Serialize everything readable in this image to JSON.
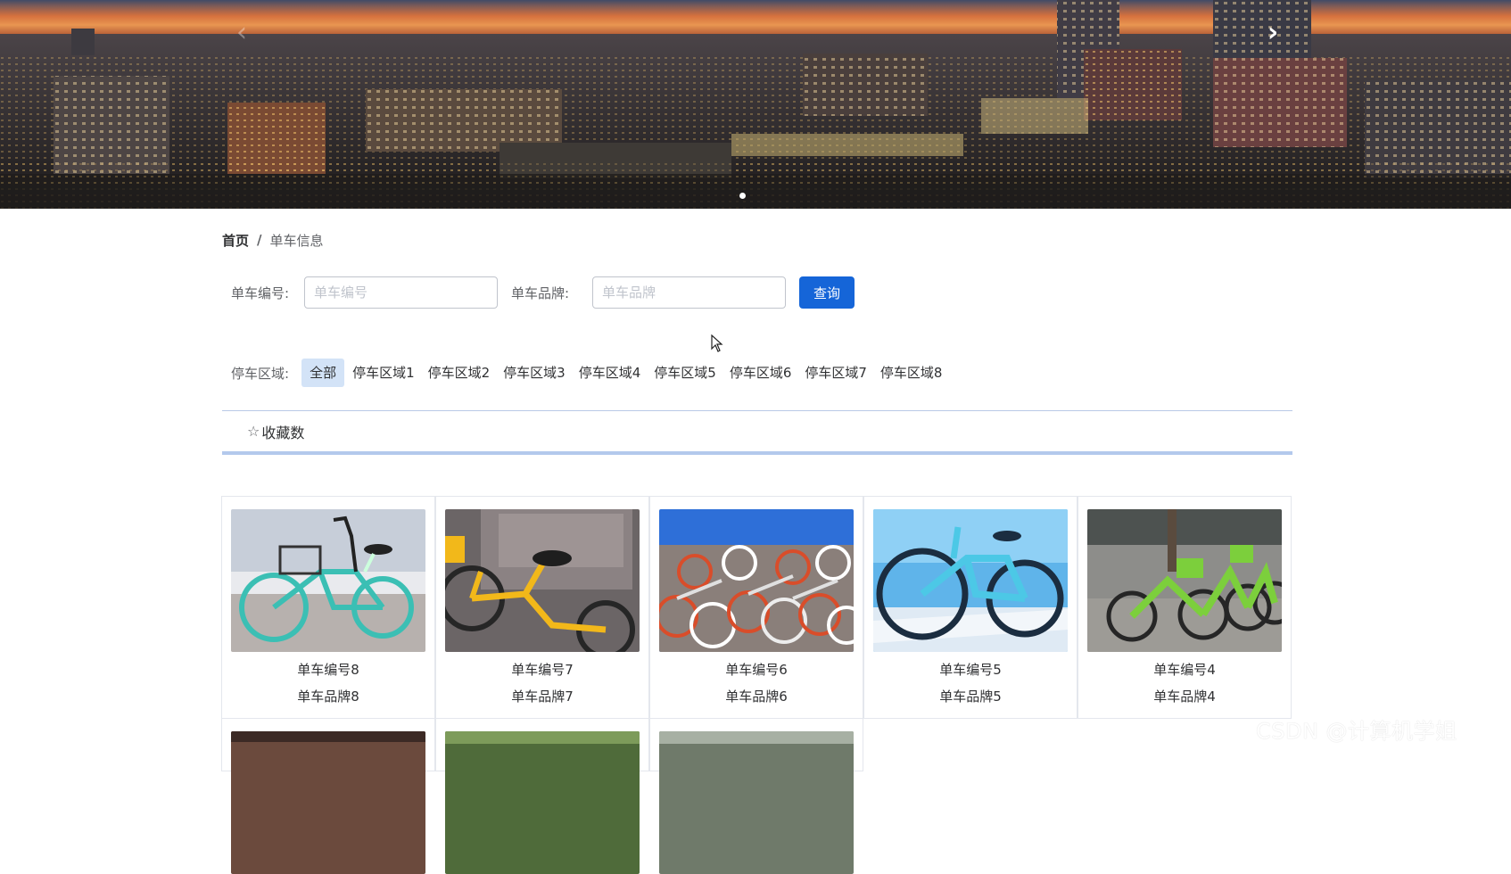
{
  "banner": {
    "prev_icon": "chevron-left-icon",
    "next_icon": "chevron-right-icon",
    "prev_glyph": "‹",
    "next_glyph": "›"
  },
  "breadcrumb": {
    "home": "首页",
    "separator": "/",
    "current": "单车信息"
  },
  "search": {
    "number_label": "单车编号:",
    "number_placeholder": "单车编号",
    "brand_label": "单车品牌:",
    "brand_placeholder": "单车品牌",
    "query_button": "查询"
  },
  "areas": {
    "label": "停车区域:",
    "items": [
      "全部",
      "停车区域1",
      "停车区域2",
      "停车区域3",
      "停车区域4",
      "停车区域5",
      "停车区域6",
      "停车区域7",
      "停车区域8"
    ],
    "selected": "全部"
  },
  "sort": {
    "icon": "star-outline-icon",
    "label": "收藏数"
  },
  "bikes": [
    {
      "number": "单车编号8",
      "brand": "单车品牌8"
    },
    {
      "number": "单车编号7",
      "brand": "单车品牌7"
    },
    {
      "number": "单车编号6",
      "brand": "单车品牌6"
    },
    {
      "number": "单车编号5",
      "brand": "单车品牌5"
    },
    {
      "number": "单车编号4",
      "brand": "单车品牌4"
    }
  ],
  "colors": {
    "primary": "#1565d8",
    "active_area_bg": "#d3e3f7",
    "sort_underline": "#b3c9ec"
  },
  "watermark": "CSDN @计算机学姐"
}
